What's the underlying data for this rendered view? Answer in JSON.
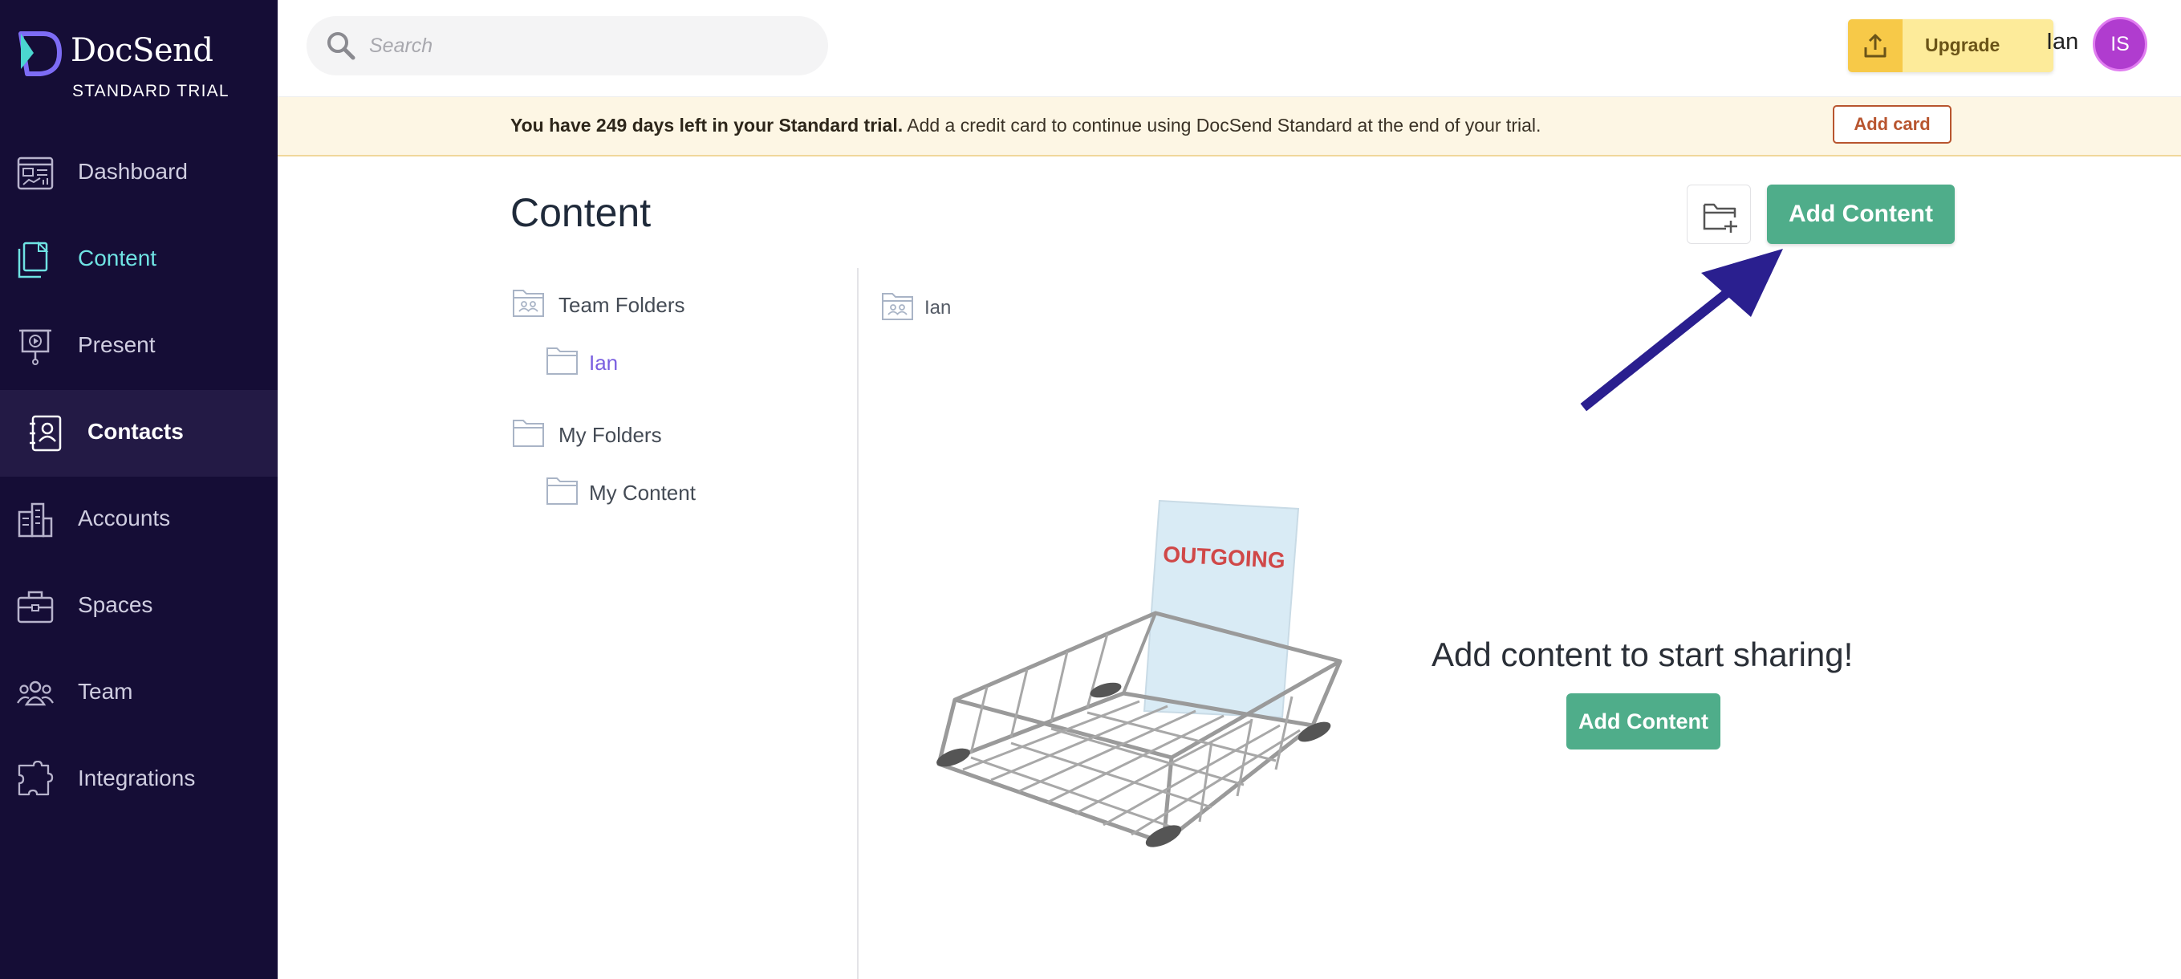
{
  "brand": {
    "name": "DocSend",
    "plan": "STANDARD TRIAL"
  },
  "sidebar": {
    "items": [
      {
        "label": "Dashboard",
        "icon": "dashboard-icon"
      },
      {
        "label": "Content",
        "icon": "content-icon",
        "state": "active"
      },
      {
        "label": "Present",
        "icon": "present-icon"
      },
      {
        "label": "Contacts",
        "icon": "contacts-icon",
        "state": "hover"
      },
      {
        "label": "Accounts",
        "icon": "accounts-icon"
      },
      {
        "label": "Spaces",
        "icon": "spaces-icon"
      },
      {
        "label": "Team",
        "icon": "team-icon"
      },
      {
        "label": "Integrations",
        "icon": "integrations-icon"
      }
    ]
  },
  "header": {
    "search_placeholder": "Search",
    "upgrade_label": "Upgrade",
    "user_name": "Ian",
    "avatar_initials": "IS"
  },
  "banner": {
    "bold_text": "You have 249 days left in your Standard trial.",
    "text": "Add a credit card to continue using DocSend Standard at the end of your trial.",
    "button_label": "Add card"
  },
  "main": {
    "title": "Content",
    "add_content_label": "Add Content",
    "tree": {
      "team_folders_label": "Team Folders",
      "team_child": "Ian",
      "my_folders_label": "My Folders",
      "my_child": "My Content"
    },
    "breadcrumb": "Ian",
    "illustration_text": "OUTGOING",
    "empty_title": "Add content to start sharing!",
    "empty_button_label": "Add Content"
  },
  "colors": {
    "sidebar_bg": "#150d36",
    "accent_teal": "#6fe3e3",
    "primary_green": "#4fad8a",
    "active_folder": "#7a5fe0",
    "annotation_arrow": "#2a1f8f",
    "upgrade_bg": "#fdeb9a"
  }
}
